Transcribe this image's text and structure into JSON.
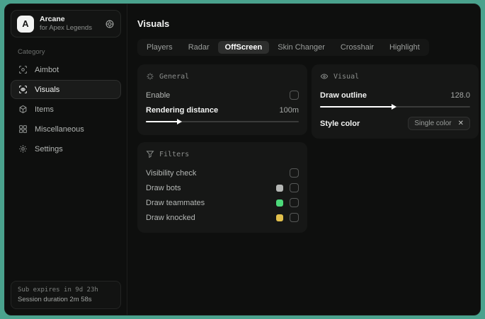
{
  "backdrop_color": "#4aa28d",
  "sidebar": {
    "brand": {
      "initial": "A",
      "name": "Arcane",
      "subtitle": "for Apex Legends"
    },
    "category_label": "Category",
    "items": [
      {
        "label": "Aimbot",
        "icon": "crosshair-icon",
        "selected": false
      },
      {
        "label": "Visuals",
        "icon": "eye-scan-icon",
        "selected": true
      },
      {
        "label": "Items",
        "icon": "cube-icon",
        "selected": false
      },
      {
        "label": "Miscellaneous",
        "icon": "grid-icon",
        "selected": false
      },
      {
        "label": "Settings",
        "icon": "gear-icon",
        "selected": false
      }
    ],
    "footer": {
      "line1": "Sub expires in 9d 23h",
      "line2": "Session duration 2m 58s"
    }
  },
  "main": {
    "title": "Visuals",
    "tabs": [
      {
        "label": "Players",
        "selected": false
      },
      {
        "label": "Radar",
        "selected": false
      },
      {
        "label": "OffScreen",
        "selected": true
      },
      {
        "label": "Skin Changer",
        "selected": false
      },
      {
        "label": "Crosshair",
        "selected": false
      },
      {
        "label": "Highlight",
        "selected": false
      }
    ],
    "panels": {
      "general": {
        "title": "General",
        "icon": "sparkle-icon",
        "enable_label": "Enable",
        "enable_checked": false,
        "distance_label": "Rendering distance",
        "distance_value": "100m",
        "distance_fill": "21%"
      },
      "filters": {
        "title": "Filters",
        "icon": "funnel-icon",
        "rows": [
          {
            "label": "Visibility check",
            "swatch": null,
            "checked": false
          },
          {
            "label": "Draw bots",
            "swatch": "#b5b7b5",
            "checked": false
          },
          {
            "label": "Draw teammates",
            "swatch": "#4cd97a",
            "checked": false
          },
          {
            "label": "Draw knocked",
            "swatch": "#e2c04c",
            "checked": false
          }
        ]
      },
      "visual": {
        "title": "Visual",
        "icon": "eye-icon",
        "outline_label": "Draw outline",
        "outline_value": "128.0",
        "outline_fill": "48%",
        "style_label": "Style color",
        "style_value": "Single color",
        "clear_icon": "✕"
      }
    }
  }
}
